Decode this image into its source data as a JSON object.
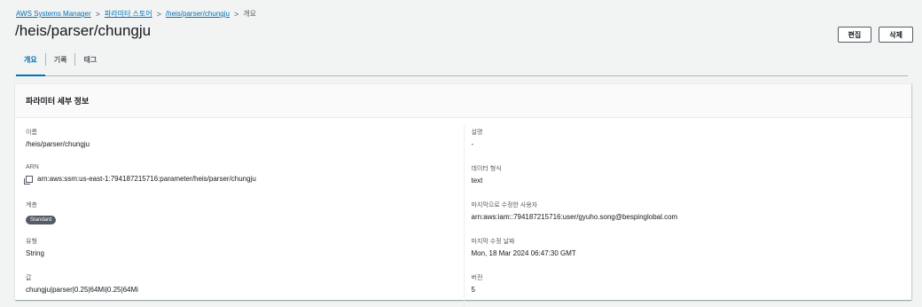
{
  "breadcrumb": {
    "items": [
      "AWS Systems Manager",
      "파라미터 스토어",
      "/heis/parser/chungju"
    ],
    "current": "개요",
    "separator": ">"
  },
  "page": {
    "title": "/heis/parser/chungju"
  },
  "actions": {
    "edit": "편집",
    "delete": "삭제"
  },
  "tabs": [
    {
      "label": "개요",
      "active": true
    },
    {
      "label": "기록",
      "active": false
    },
    {
      "label": "태그",
      "active": false
    }
  ],
  "panel": {
    "title": "파라미터 세부 정보"
  },
  "fields_left": {
    "name": {
      "label": "이름",
      "value": "/heis/parser/chungju"
    },
    "arn": {
      "label": "ARN",
      "value": "arn:aws:ssm:us-east-1:794187215716:parameter/heis/parser/chungju"
    },
    "tier": {
      "label": "계층",
      "value": "Standard"
    },
    "type": {
      "label": "유형",
      "value": "String"
    },
    "value": {
      "label": "값",
      "value": "chungju|parser|0.25|64Mi|0.25|64Mi"
    }
  },
  "fields_right": {
    "description": {
      "label": "설명",
      "value": "-"
    },
    "data_type": {
      "label": "데이터 형식",
      "value": "text"
    },
    "last_modified_user": {
      "label": "마지막으로 수정한 사용자",
      "value": "arn:aws:iam::794187215716:user/gyuho.song@bespinglobal.com"
    },
    "last_modified_date": {
      "label": "마지막 수정 날짜",
      "value": "Mon, 18 Mar 2024 06:47:30 GMT"
    },
    "version": {
      "label": "버전",
      "value": "5"
    }
  },
  "colors": {
    "accent": "#0073bb",
    "badge": "#545b64",
    "background": "#f2f3f3"
  },
  "icons": {
    "arn_copy": "copy-icon"
  }
}
